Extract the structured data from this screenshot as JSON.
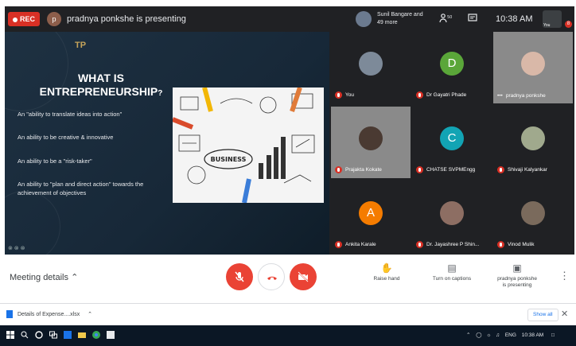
{
  "topbar": {
    "rec_label": "REC",
    "presenter_initial": "p",
    "presenting_text": "pradnya ponkshe is presenting",
    "people_text": "Sunil Bangare and 49 more",
    "time": "10:38 AM",
    "self_label": "You",
    "notification_count": "8"
  },
  "slide": {
    "logo_text": "TP",
    "title_line1": "WHAT IS",
    "title_line2": "ENTREPRENEURSHIP",
    "title_suffix": "?",
    "bullets": [
      "An \"ability to translate ideas into action\"",
      "An ability to be creative & innovative",
      "An ability to be a \"risk-taker\"",
      "An ability to \"plan and direct action\" towards the achievement of objectives"
    ],
    "image_caption": "BUSINESS",
    "footer": "⊗ ⊗ ⊗"
  },
  "participants": [
    {
      "name": "You",
      "type": "photo",
      "color": "#7d8a99"
    },
    {
      "name": "Dr Gayatri Phade",
      "type": "letter",
      "letter": "D",
      "color": "#5aa639"
    },
    {
      "name": "pradnya ponkshe",
      "type": "video",
      "color": "#9b9b9b"
    },
    {
      "name": "Prajakta Kokate",
      "type": "video",
      "color": "#6b5b4f"
    },
    {
      "name": "CHATSE SVPMEngg",
      "type": "letter",
      "letter": "C",
      "color": "#12a4b4"
    },
    {
      "name": "Shivaji Kalyankar",
      "type": "photo",
      "color": "#a0a98d"
    },
    {
      "name": "Ankita Karale",
      "type": "letter",
      "letter": "A",
      "color": "#f57c00"
    },
    {
      "name": "Dr. Jayashree P Shin...",
      "type": "photo",
      "color": "#8d6e63"
    },
    {
      "name": "Vinod Mulik",
      "type": "photo",
      "color": "#7a6a5c"
    }
  ],
  "bottombar": {
    "meeting_details": "Meeting details",
    "raise_hand": "Raise hand",
    "captions": "Turn on captions",
    "presenting_line1": "pradnya ponkshe",
    "presenting_line2": "is presenting"
  },
  "downloads": {
    "file_name": "Details of Expense....xlsx",
    "show_all": "Show all"
  },
  "taskbar": {
    "lang": "ENG",
    "time": "10:38 AM"
  },
  "colors": {
    "end_call": "#ea4335",
    "meet_dark": "#202124",
    "accent": "#1a73e8"
  }
}
